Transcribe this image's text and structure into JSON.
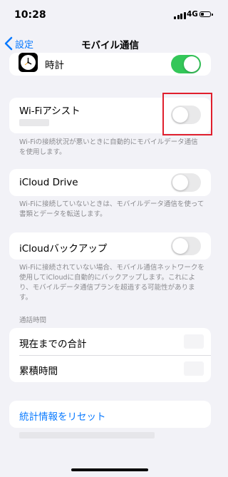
{
  "status_bar": {
    "time": "10:28",
    "network": "4G",
    "signal_bars": 4,
    "battery_level": 0.3
  },
  "nav": {
    "back_label": "設定",
    "title": "モバイル通信"
  },
  "clock_row": {
    "label": "時計",
    "icon": "clock-icon",
    "toggle_on": true
  },
  "wifi_assist": {
    "label": "Wi-Fiアシスト",
    "toggle_on": false,
    "footnote": "Wi-Fiの接続状況が悪いときに自動的にモバイルデータ通信を使用します。"
  },
  "icloud_drive": {
    "label": "iCloud Drive",
    "toggle_on": false,
    "footnote": "Wi-Fiに接続していないときは、モバイルデータ通信を使って書類とデータを転送します。"
  },
  "icloud_backup": {
    "label": "iCloudバックアップ",
    "toggle_on": false,
    "footnote": "Wi-Fiに接続されていない場合、モバイル通信ネットワークを使用してiCloudに自動的にバックアップします。これにより、モバイルデータ通信プランを超過する可能性があります。"
  },
  "call_time": {
    "header": "通話時間",
    "current_total_label": "現在までの合計",
    "cumulative_label": "累積時間"
  },
  "reset": {
    "label": "統計情報をリセット"
  },
  "colors": {
    "accent": "#0a7aff",
    "toggle_on": "#34c759",
    "highlight": "#e01f2d"
  }
}
